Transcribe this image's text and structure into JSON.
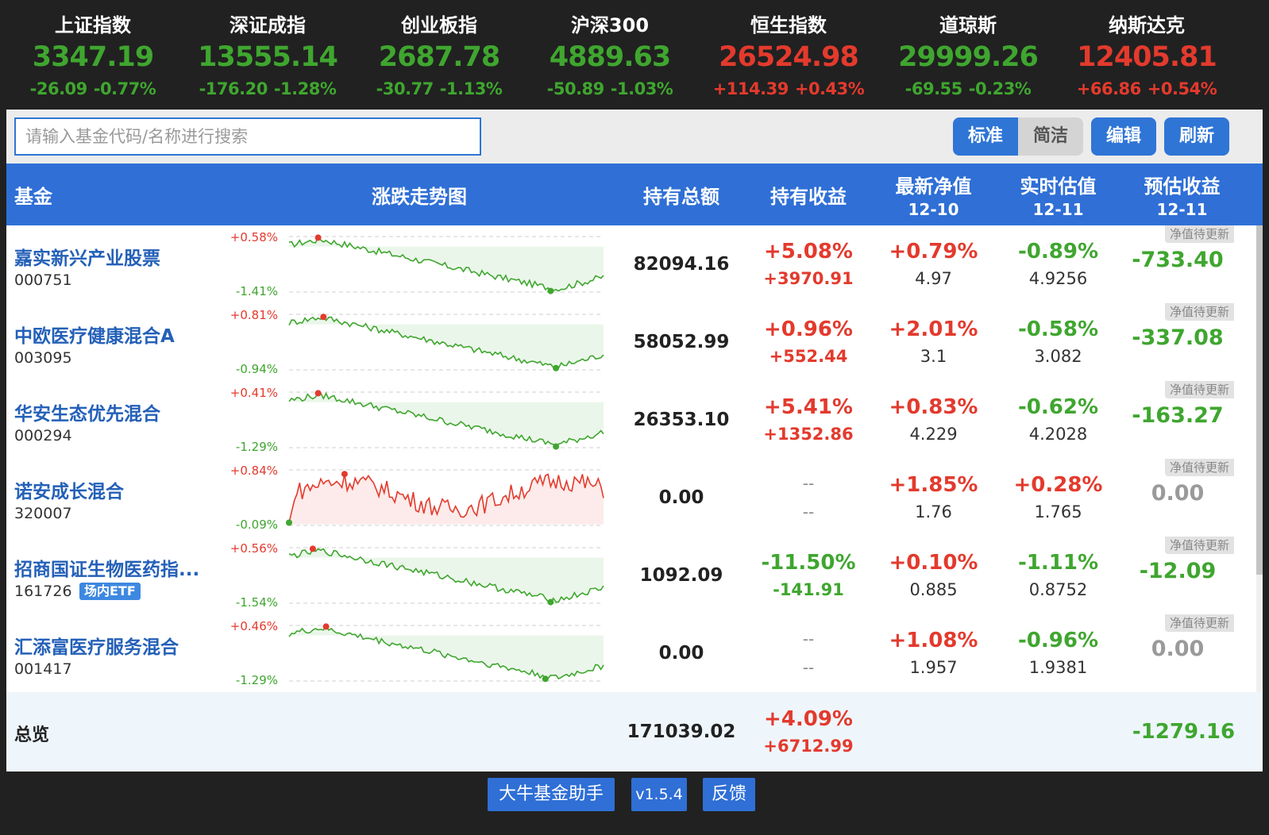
{
  "indices": [
    {
      "name": "上证指数",
      "value": "3347.19",
      "change": "-26.09",
      "pct": "-0.77%",
      "dir": "down"
    },
    {
      "name": "深证成指",
      "value": "13555.14",
      "change": "-176.20",
      "pct": "-1.28%",
      "dir": "down"
    },
    {
      "name": "创业板指",
      "value": "2687.78",
      "change": "-30.77",
      "pct": "-1.13%",
      "dir": "down"
    },
    {
      "name": "沪深300",
      "value": "4889.63",
      "change": "-50.89",
      "pct": "-1.03%",
      "dir": "down"
    },
    {
      "name": "恒生指数",
      "value": "26524.98",
      "change": "+114.39",
      "pct": "+0.43%",
      "dir": "up"
    },
    {
      "name": "道琼斯",
      "value": "29999.26",
      "change": "-69.55",
      "pct": "-0.23%",
      "dir": "down"
    },
    {
      "name": "纳斯达克",
      "value": "12405.81",
      "change": "+66.86",
      "pct": "+0.54%",
      "dir": "up"
    }
  ],
  "toolbar": {
    "search_placeholder": "请输入基金代码/名称进行搜索",
    "mode_standard": "标准",
    "mode_simple": "简洁",
    "edit": "编辑",
    "refresh": "刷新"
  },
  "header": {
    "fund": "基金",
    "trend": "涨跌走势图",
    "amount": "持有总额",
    "profit": "持有收益",
    "nav": "最新净值",
    "nav_date": "12-10",
    "est": "实时估值",
    "est_date": "12-11",
    "est_profit": "预估收益",
    "est_profit_date": "12-11"
  },
  "funds": [
    {
      "name": "嘉实新兴产业股票",
      "code": "000751",
      "tag": "",
      "max": "+0.58%",
      "min": "-1.41%",
      "trend": "down",
      "amount": "82094.16",
      "hold_pct": "+5.08%",
      "hold_amt": "+3970.91",
      "hold_dir": "up",
      "nav_pct": "+0.79%",
      "nav": "4.97",
      "nav_dir": "up",
      "est_pct": "-0.89%",
      "est": "4.9256",
      "est_dir": "down",
      "pending": "净值待更新",
      "est_profit": "-733.40",
      "est_profit_dir": "down"
    },
    {
      "name": "中欧医疗健康混合A",
      "code": "003095",
      "tag": "",
      "max": "+0.81%",
      "min": "-0.94%",
      "trend": "down",
      "amount": "58052.99",
      "hold_pct": "+0.96%",
      "hold_amt": "+552.44",
      "hold_dir": "up",
      "nav_pct": "+2.01%",
      "nav": "3.1",
      "nav_dir": "up",
      "est_pct": "-0.58%",
      "est": "3.082",
      "est_dir": "down",
      "pending": "净值待更新",
      "est_profit": "-337.08",
      "est_profit_dir": "down"
    },
    {
      "name": "华安生态优先混合",
      "code": "000294",
      "tag": "",
      "max": "+0.41%",
      "min": "-1.29%",
      "trend": "down",
      "amount": "26353.10",
      "hold_pct": "+5.41%",
      "hold_amt": "+1352.86",
      "hold_dir": "up",
      "nav_pct": "+0.83%",
      "nav": "4.229",
      "nav_dir": "up",
      "est_pct": "-0.62%",
      "est": "4.2028",
      "est_dir": "down",
      "pending": "净值待更新",
      "est_profit": "-163.27",
      "est_profit_dir": "down"
    },
    {
      "name": "诺安成长混合",
      "code": "320007",
      "tag": "",
      "max": "+0.84%",
      "min": "-0.09%",
      "trend": "up",
      "amount": "0.00",
      "hold_pct": "--",
      "hold_amt": "--",
      "hold_dir": "none",
      "nav_pct": "+1.85%",
      "nav": "1.76",
      "nav_dir": "up",
      "est_pct": "+0.28%",
      "est": "1.765",
      "est_dir": "up",
      "pending": "净值待更新",
      "est_profit": "0.00",
      "est_profit_dir": "zero"
    },
    {
      "name": "招商国证生物医药指...",
      "code": "161726",
      "tag": "场内ETF",
      "max": "+0.56%",
      "min": "-1.54%",
      "trend": "down",
      "amount": "1092.09",
      "hold_pct": "-11.50%",
      "hold_amt": "-141.91",
      "hold_dir": "down",
      "nav_pct": "+0.10%",
      "nav": "0.885",
      "nav_dir": "up",
      "est_pct": "-1.11%",
      "est": "0.8752",
      "est_dir": "down",
      "pending": "净值待更新",
      "est_profit": "-12.09",
      "est_profit_dir": "down"
    },
    {
      "name": "汇添富医疗服务混合",
      "code": "001417",
      "tag": "",
      "max": "+0.46%",
      "min": "-1.29%",
      "trend": "down",
      "amount": "0.00",
      "hold_pct": "--",
      "hold_amt": "--",
      "hold_dir": "none",
      "nav_pct": "+1.08%",
      "nav": "1.957",
      "nav_dir": "up",
      "est_pct": "-0.96%",
      "est": "1.9381",
      "est_dir": "down",
      "pending": "净值待更新",
      "est_profit": "0.00",
      "est_profit_dir": "zero"
    }
  ],
  "summary": {
    "label": "总览",
    "amount": "171039.02",
    "hold_pct": "+4.09%",
    "hold_amt": "+6712.99",
    "est_profit": "-1279.16"
  },
  "footer": {
    "app": "大牛基金助手",
    "version": "v1.5.4",
    "feedback": "反馈"
  },
  "colors": {
    "up": "#e33a2d",
    "down": "#3fa62f",
    "accent": "#2f75d6"
  }
}
